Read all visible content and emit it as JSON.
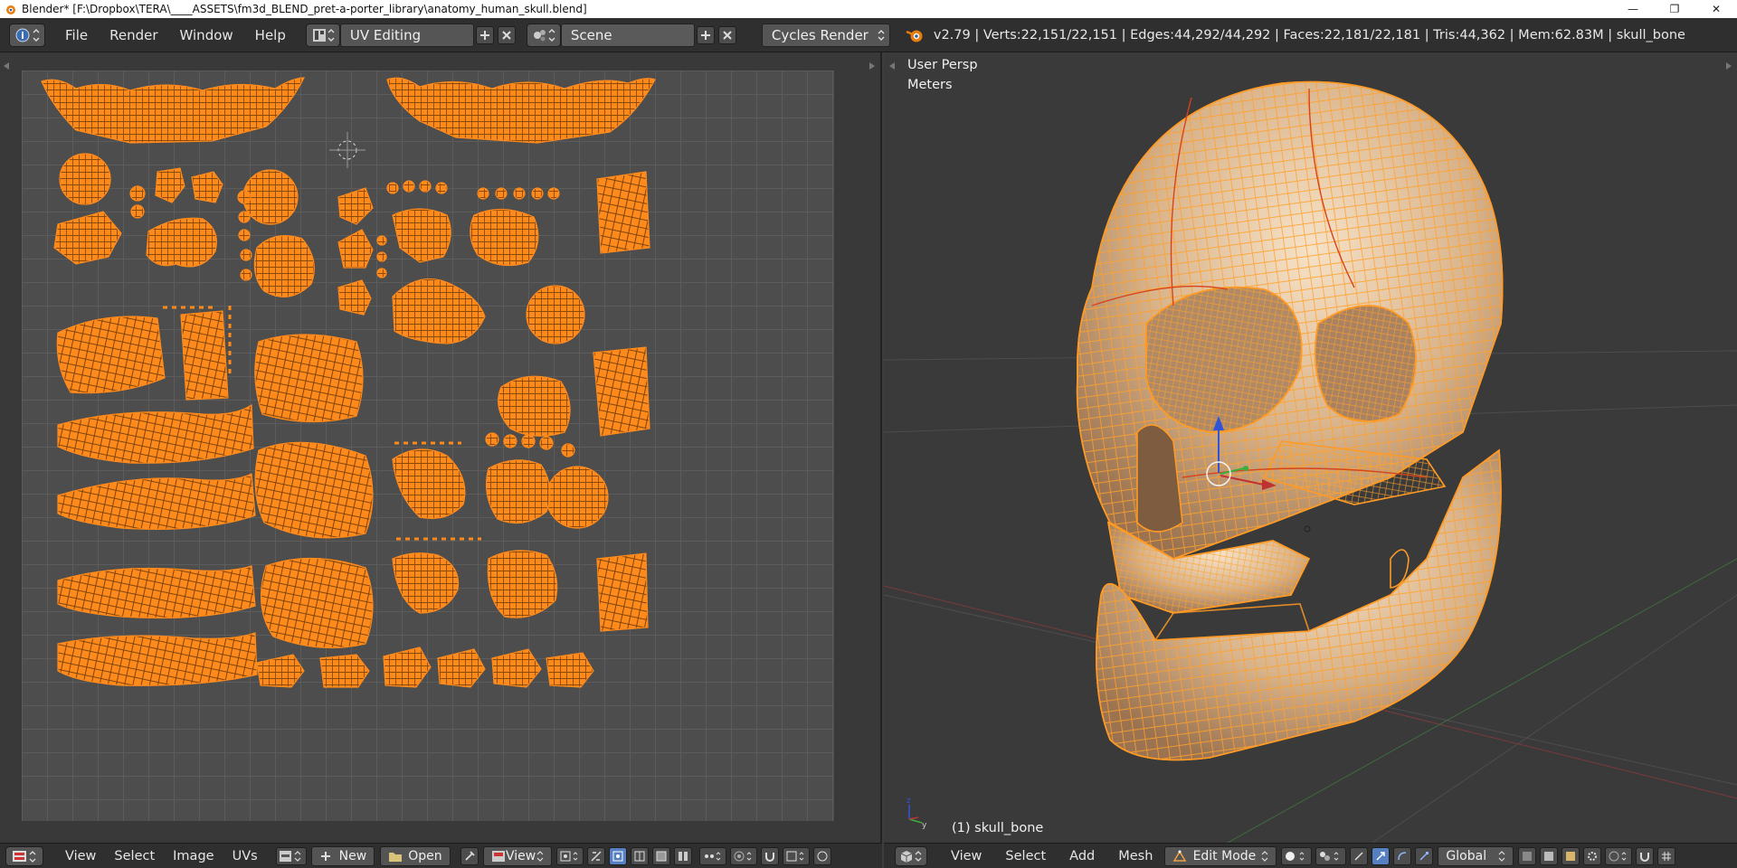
{
  "window": {
    "title": "Blender* [F:\\Dropbox\\TERA\\____ASSETS\\fm3d_BLEND_pret-a-porter_library\\anatomy_human_skull.blend]",
    "controls": [
      "—",
      "❐",
      "✕"
    ]
  },
  "topbar": {
    "menus": [
      "File",
      "Render",
      "Window",
      "Help"
    ],
    "screen_layout": "UV Editing",
    "scene": "Scene",
    "render_engine": "Cycles Render",
    "stats": "v2.79 | Verts:22,151/22,151 | Edges:44,292/44,292 | Faces:22,181/22,181 | Tris:44,362 | Mem:62.83M | skull_bone"
  },
  "uv_editor": {
    "menus": [
      "View",
      "Select",
      "Image",
      "UVs"
    ],
    "new_label": "New",
    "open_label": "Open",
    "view_label": "View"
  },
  "viewport": {
    "view_name": "User Persp",
    "units": "Meters",
    "object_label": "(1) skull_bone",
    "menus": [
      "View",
      "Select",
      "Add",
      "Mesh"
    ],
    "mode": "Edit Mode",
    "orientation": "Global"
  },
  "colors": {
    "uv_islands": "#ff8a1c",
    "skull_wire": "#ffa12a",
    "header_bg": "#2f2f2f",
    "panel_bg": "#393939"
  }
}
